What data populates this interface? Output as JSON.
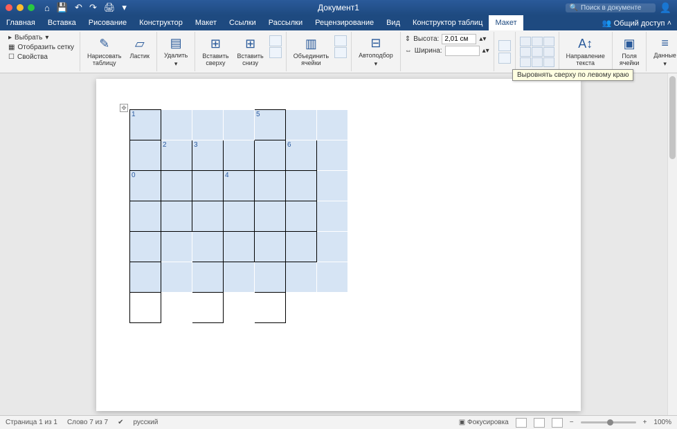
{
  "title": "Документ1",
  "search_placeholder": "Поиск в документе",
  "qat_icons": [
    "home",
    "save",
    "undo",
    "redo",
    "print",
    "more"
  ],
  "tabs": [
    "Главная",
    "Вставка",
    "Рисование",
    "Конструктор",
    "Макет",
    "Ссылки",
    "Рассылки",
    "Рецензирование",
    "Вид",
    "Конструктор таблиц",
    "Макет"
  ],
  "active_tab_index": 10,
  "share_label": "Общий доступ",
  "ribbon": {
    "select": "Выбрать",
    "gridlines": "Отобразить сетку",
    "properties": "Свойства",
    "draw_table": "Нарисовать\nтаблицу",
    "eraser": "Ластик",
    "delete": "Удалить",
    "insert_above": "Вставить\nсверху",
    "insert_below": "Вставить\nснизу",
    "merge": "Объединить\nячейки",
    "autofit": "Автоподбор",
    "height_label": "Высота:",
    "height_value": "2,01 см",
    "width_label": "Ширина:",
    "width_value": "",
    "text_dir": "Направление\nтекста",
    "cell_margins": "Поля\nячейки",
    "data": "Данные"
  },
  "tooltip": "Выровнять сверху по левому краю",
  "table_labels": {
    "r0": [
      "1",
      "",
      "",
      "",
      "5",
      "",
      ""
    ],
    "r1": [
      "",
      "2",
      "3",
      "",
      "",
      "6",
      ""
    ],
    "r2": [
      "0",
      "",
      "",
      "4",
      "",
      "",
      ""
    ]
  },
  "status": {
    "page": "Страница 1 из 1",
    "words": "Слово 7 из 7",
    "lang": "русский",
    "focus": "Фокусировка",
    "zoom": "100%"
  }
}
